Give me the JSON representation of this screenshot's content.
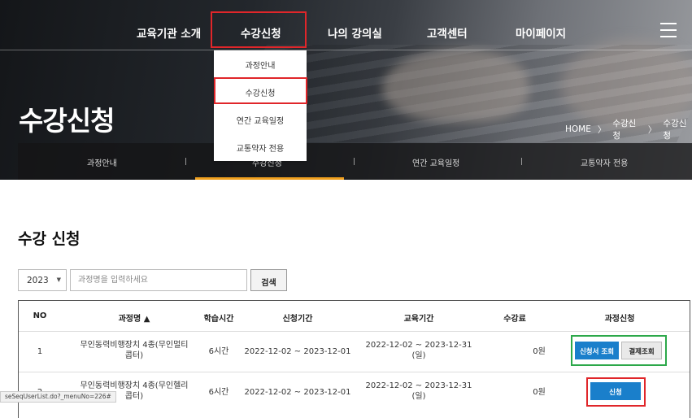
{
  "nav": {
    "items": [
      "교육기관 소개",
      "수강신청",
      "나의 강의실",
      "고객센터",
      "마이페이지"
    ],
    "menu_icon": "hamburger-icon"
  },
  "dropdown": {
    "items": [
      "과정안내",
      "수강신청",
      "연간 교육일정",
      "교통약자 전용"
    ]
  },
  "hero": {
    "title": "수강신청",
    "breadcrumb": [
      "HOME",
      "수강신청",
      "수강신청"
    ],
    "breadcrumb_separator": "〉"
  },
  "subnav": {
    "items": [
      "과정안내",
      "수강신청",
      "연간 교육일정",
      "교통약자 전용"
    ],
    "active_index": 1,
    "active_color": "#f0a01e"
  },
  "main": {
    "heading": "수강 신청",
    "year": "2023",
    "year_caret": "▼",
    "search_placeholder": "과정명을 입력하세요",
    "search_button": "검색"
  },
  "table": {
    "headers": [
      "NO",
      "과정명 ▲",
      "학습시간",
      "신청기간",
      "교육기간",
      "수강료",
      "과정신청"
    ],
    "rows": [
      {
        "no": "1",
        "course": [
          "무인동력비행장치 4종(무인멀티",
          "콥터)"
        ],
        "hours": "6시간",
        "apply_period": "2022-12-02 ~ 2023-12-01",
        "edu_period": [
          "2022-12-02 ~ 2023-12-31",
          "(일)"
        ],
        "fee": "0원",
        "actions": [
          "신청서 조회",
          "결제조회"
        ]
      },
      {
        "no": "2",
        "course": [
          "무인동력비행장치 4종(무인헬리",
          "콥터)"
        ],
        "hours": "6시간",
        "apply_period": "2022-12-02 ~ 2023-12-01",
        "edu_period": [
          "2022-12-02 ~ 2023-12-31",
          "(일)"
        ],
        "fee": "0원",
        "actions": [
          "신청"
        ]
      }
    ]
  },
  "status_bar": {
    "url": "seSeqUserList.do?_menuNo=226#"
  },
  "colors": {
    "highlight_red": "#e0262a",
    "highlight_green": "#2ca84a",
    "button_blue": "#1a7fcb"
  }
}
